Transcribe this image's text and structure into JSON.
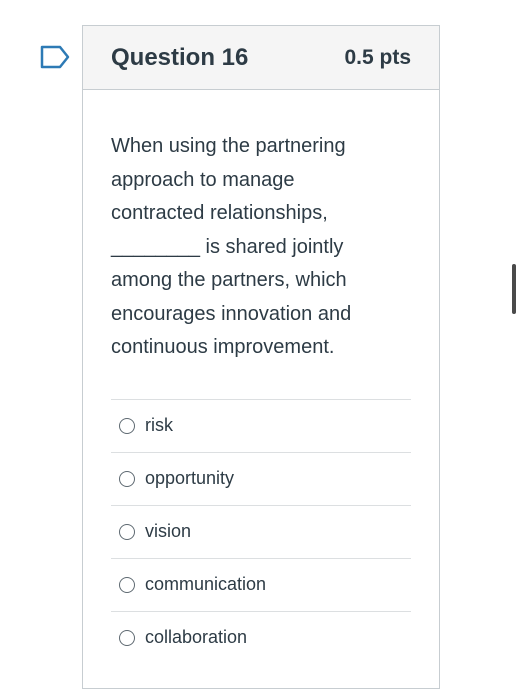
{
  "question": {
    "title": "Question 16",
    "points": "0.5 pts",
    "text": "When using the partnering approach to manage contracted relationships, ________ is shared jointly among the partners, which encourages innovation and continuous improvement.",
    "flag_icon": "bookmark-flag-icon"
  },
  "answers": [
    {
      "label": "risk"
    },
    {
      "label": "opportunity"
    },
    {
      "label": "vision"
    },
    {
      "label": "communication"
    },
    {
      "label": "collaboration"
    }
  ],
  "colors": {
    "flag": "#2d7ab5",
    "text": "#2d3b45",
    "header_bg": "#f5f5f5",
    "border": "#c7cdd1"
  }
}
